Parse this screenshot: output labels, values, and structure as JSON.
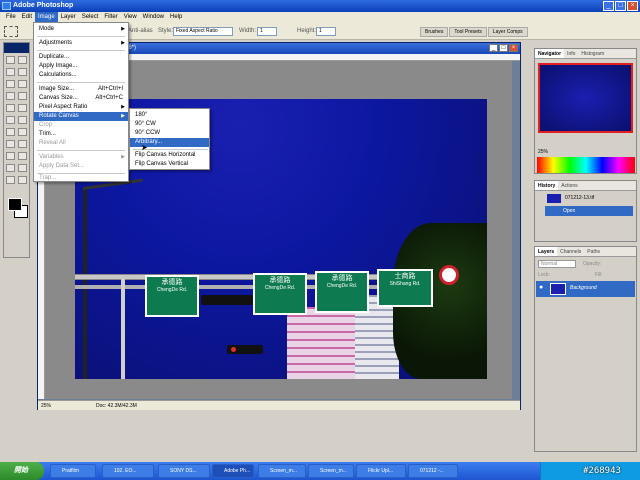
{
  "app": {
    "title": "Adobe Photoshop"
  },
  "menubar": [
    "File",
    "Edit",
    "Image",
    "Layer",
    "Select",
    "Filter",
    "View",
    "Window",
    "Help"
  ],
  "options": {
    "style_label": "Style:",
    "style_value": "Fixed Aspect Ratio",
    "width_label": "Width:",
    "width_value": "1",
    "height_label": "Height:",
    "height_value": "1",
    "antialias_label": "Anti-alias"
  },
  "palette_well": [
    "Brushes",
    "Tool Presets",
    "Layer Comps"
  ],
  "document": {
    "title": "(1/16*)",
    "zoom": "25%",
    "doc_size": "Doc: 42.3M/42.3M"
  },
  "image_menu": {
    "items": [
      {
        "label": "Mode",
        "arrow": true
      },
      {
        "label": "Adjustments",
        "arrow": true
      },
      {
        "label": "Duplicate..."
      },
      {
        "label": "Apply Image..."
      },
      {
        "label": "Calculations..."
      },
      {
        "label": "Image Size...",
        "shortcut": "Alt+Ctrl+I"
      },
      {
        "label": "Canvas Size...",
        "shortcut": "Alt+Ctrl+C"
      },
      {
        "label": "Pixel Aspect Ratio",
        "arrow": true
      },
      {
        "label": "Rotate Canvas",
        "arrow": true
      },
      {
        "label": "Crop"
      },
      {
        "label": "Trim..."
      },
      {
        "label": "Reveal All"
      },
      {
        "label": "Variables",
        "arrow": true
      },
      {
        "label": "Apply Data Set..."
      },
      {
        "label": "Trap..."
      }
    ]
  },
  "rotate_submenu": [
    "180°",
    "90° CW",
    "90° CCW",
    "Arbitrary...",
    "Flip Canvas Horizontal",
    "Flip Canvas Vertical"
  ],
  "navigator": {
    "tabs": [
      "Navigator",
      "Info",
      "Histogram"
    ],
    "zoom": "25%"
  },
  "history": {
    "tabs": [
      "History",
      "Actions"
    ],
    "snapshot": "071212-13.tif",
    "state": "Open"
  },
  "layers": {
    "tabs": [
      "Layers",
      "Channels",
      "Paths"
    ],
    "blend": "Normal",
    "opacity_label": "Opacity:",
    "fill_label": "Fill:",
    "lock_label": "Lock:",
    "layer_name": "Background"
  },
  "signs": [
    {
      "zh": "承德路",
      "en": "ChengDe Rd."
    },
    {
      "zh": "承德路",
      "en": "ChengDe Rd."
    },
    {
      "zh": "承德路",
      "en": "ChengDe Rd."
    },
    {
      "zh": "士商路",
      "en": "ShiShang Rd."
    }
  ],
  "taskbar": {
    "start": "開始",
    "items": [
      "Pratfilm",
      "102. EO...",
      "SONY DS...",
      "Adobe Ph...",
      "Screen_m...",
      "Screen_m...",
      "Flickr Upl...",
      "071212 -..."
    ],
    "id_tag": "#268943"
  },
  "colors": {
    "accent": "#316ac5",
    "sign_green": "#0e7a4f",
    "sky": "#0c17a0"
  }
}
